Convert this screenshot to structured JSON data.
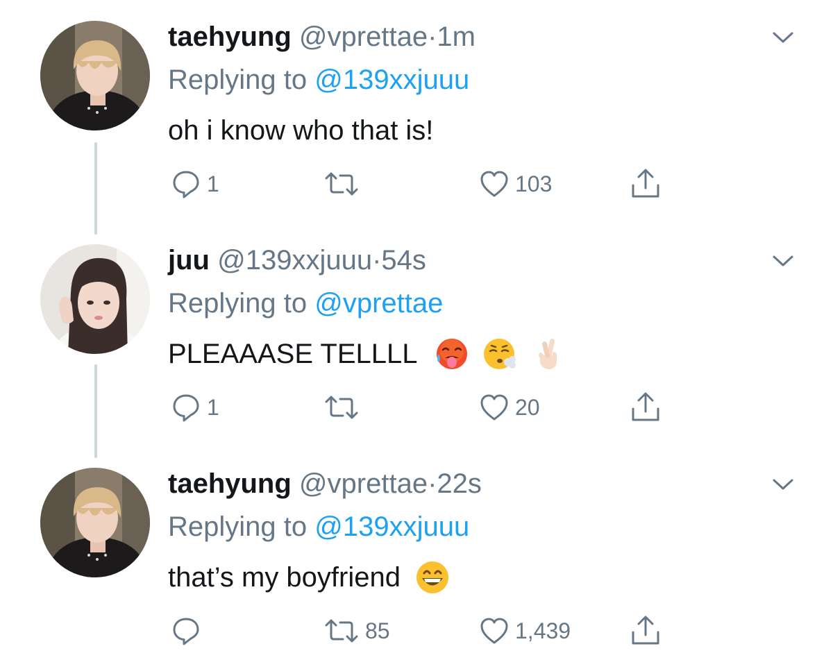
{
  "tweets": [
    {
      "name": "taehyung",
      "handle": "@vprettae",
      "separator": "·",
      "time": "1m",
      "replying_prefix": "Replying to",
      "replying_to": "@139xxjuuu",
      "text": "oh i know who that is!",
      "emojis": [],
      "reply_count": "1",
      "retweet_count": "",
      "like_count": "103"
    },
    {
      "name": "juu",
      "handle": "@139xxjuuu",
      "separator": "·",
      "time": "54s",
      "replying_prefix": "Replying to",
      "replying_to": "@vprettae",
      "text": "PLEAAASE TELLLL",
      "emojis": [
        "hot-face-emoji",
        "face-exhaling-emoji",
        "crossed-fingers-emoji"
      ],
      "reply_count": "1",
      "retweet_count": "",
      "like_count": "20"
    },
    {
      "name": "taehyung",
      "handle": "@vprettae",
      "separator": "·",
      "time": "22s",
      "replying_prefix": "Replying to",
      "replying_to": "@139xxjuuu",
      "text": "that’s my boyfriend",
      "emojis": [
        "grinning-face-emoji"
      ],
      "reply_count": "",
      "retweet_count": "85",
      "like_count": "1,439"
    }
  ],
  "colors": {
    "text": "#14171a",
    "secondary": "#657786",
    "link": "#1da1f2",
    "thread_line": "#ccd6dd",
    "background": "#ffffff"
  },
  "icons": [
    "reply-icon",
    "retweet-icon",
    "like-icon",
    "share-icon",
    "chevron-down-icon"
  ]
}
